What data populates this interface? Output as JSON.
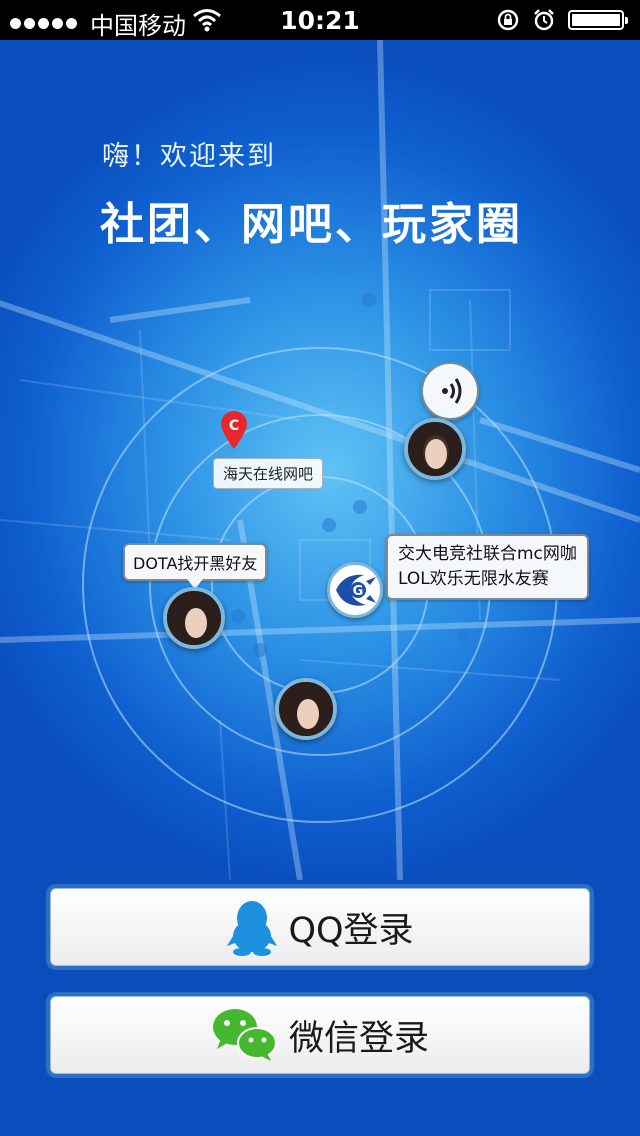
{
  "status_bar": {
    "carrier": "中国移动",
    "time": "10:21"
  },
  "intro": {
    "greeting": "嗨！欢迎来到",
    "headline": "社团、网吧、玩家圈"
  },
  "map": {
    "location_label": "海天在线网吧",
    "location_marker": "C",
    "bubble_left": "DOTA找开黑好友",
    "bubble_right_line1": "交大电竞社联合mc网咖",
    "bubble_right_line2": "LOL欢乐无限水友赛"
  },
  "buttons": {
    "qq_login": "QQ登录",
    "wechat_login": "微信登录"
  },
  "colors": {
    "bg_center": "#5fc3f5",
    "bg_edge": "#0a4dbd",
    "qq_blue": "#1d90e0",
    "wechat_green": "#46b830",
    "marker_red": "#e8262b"
  }
}
